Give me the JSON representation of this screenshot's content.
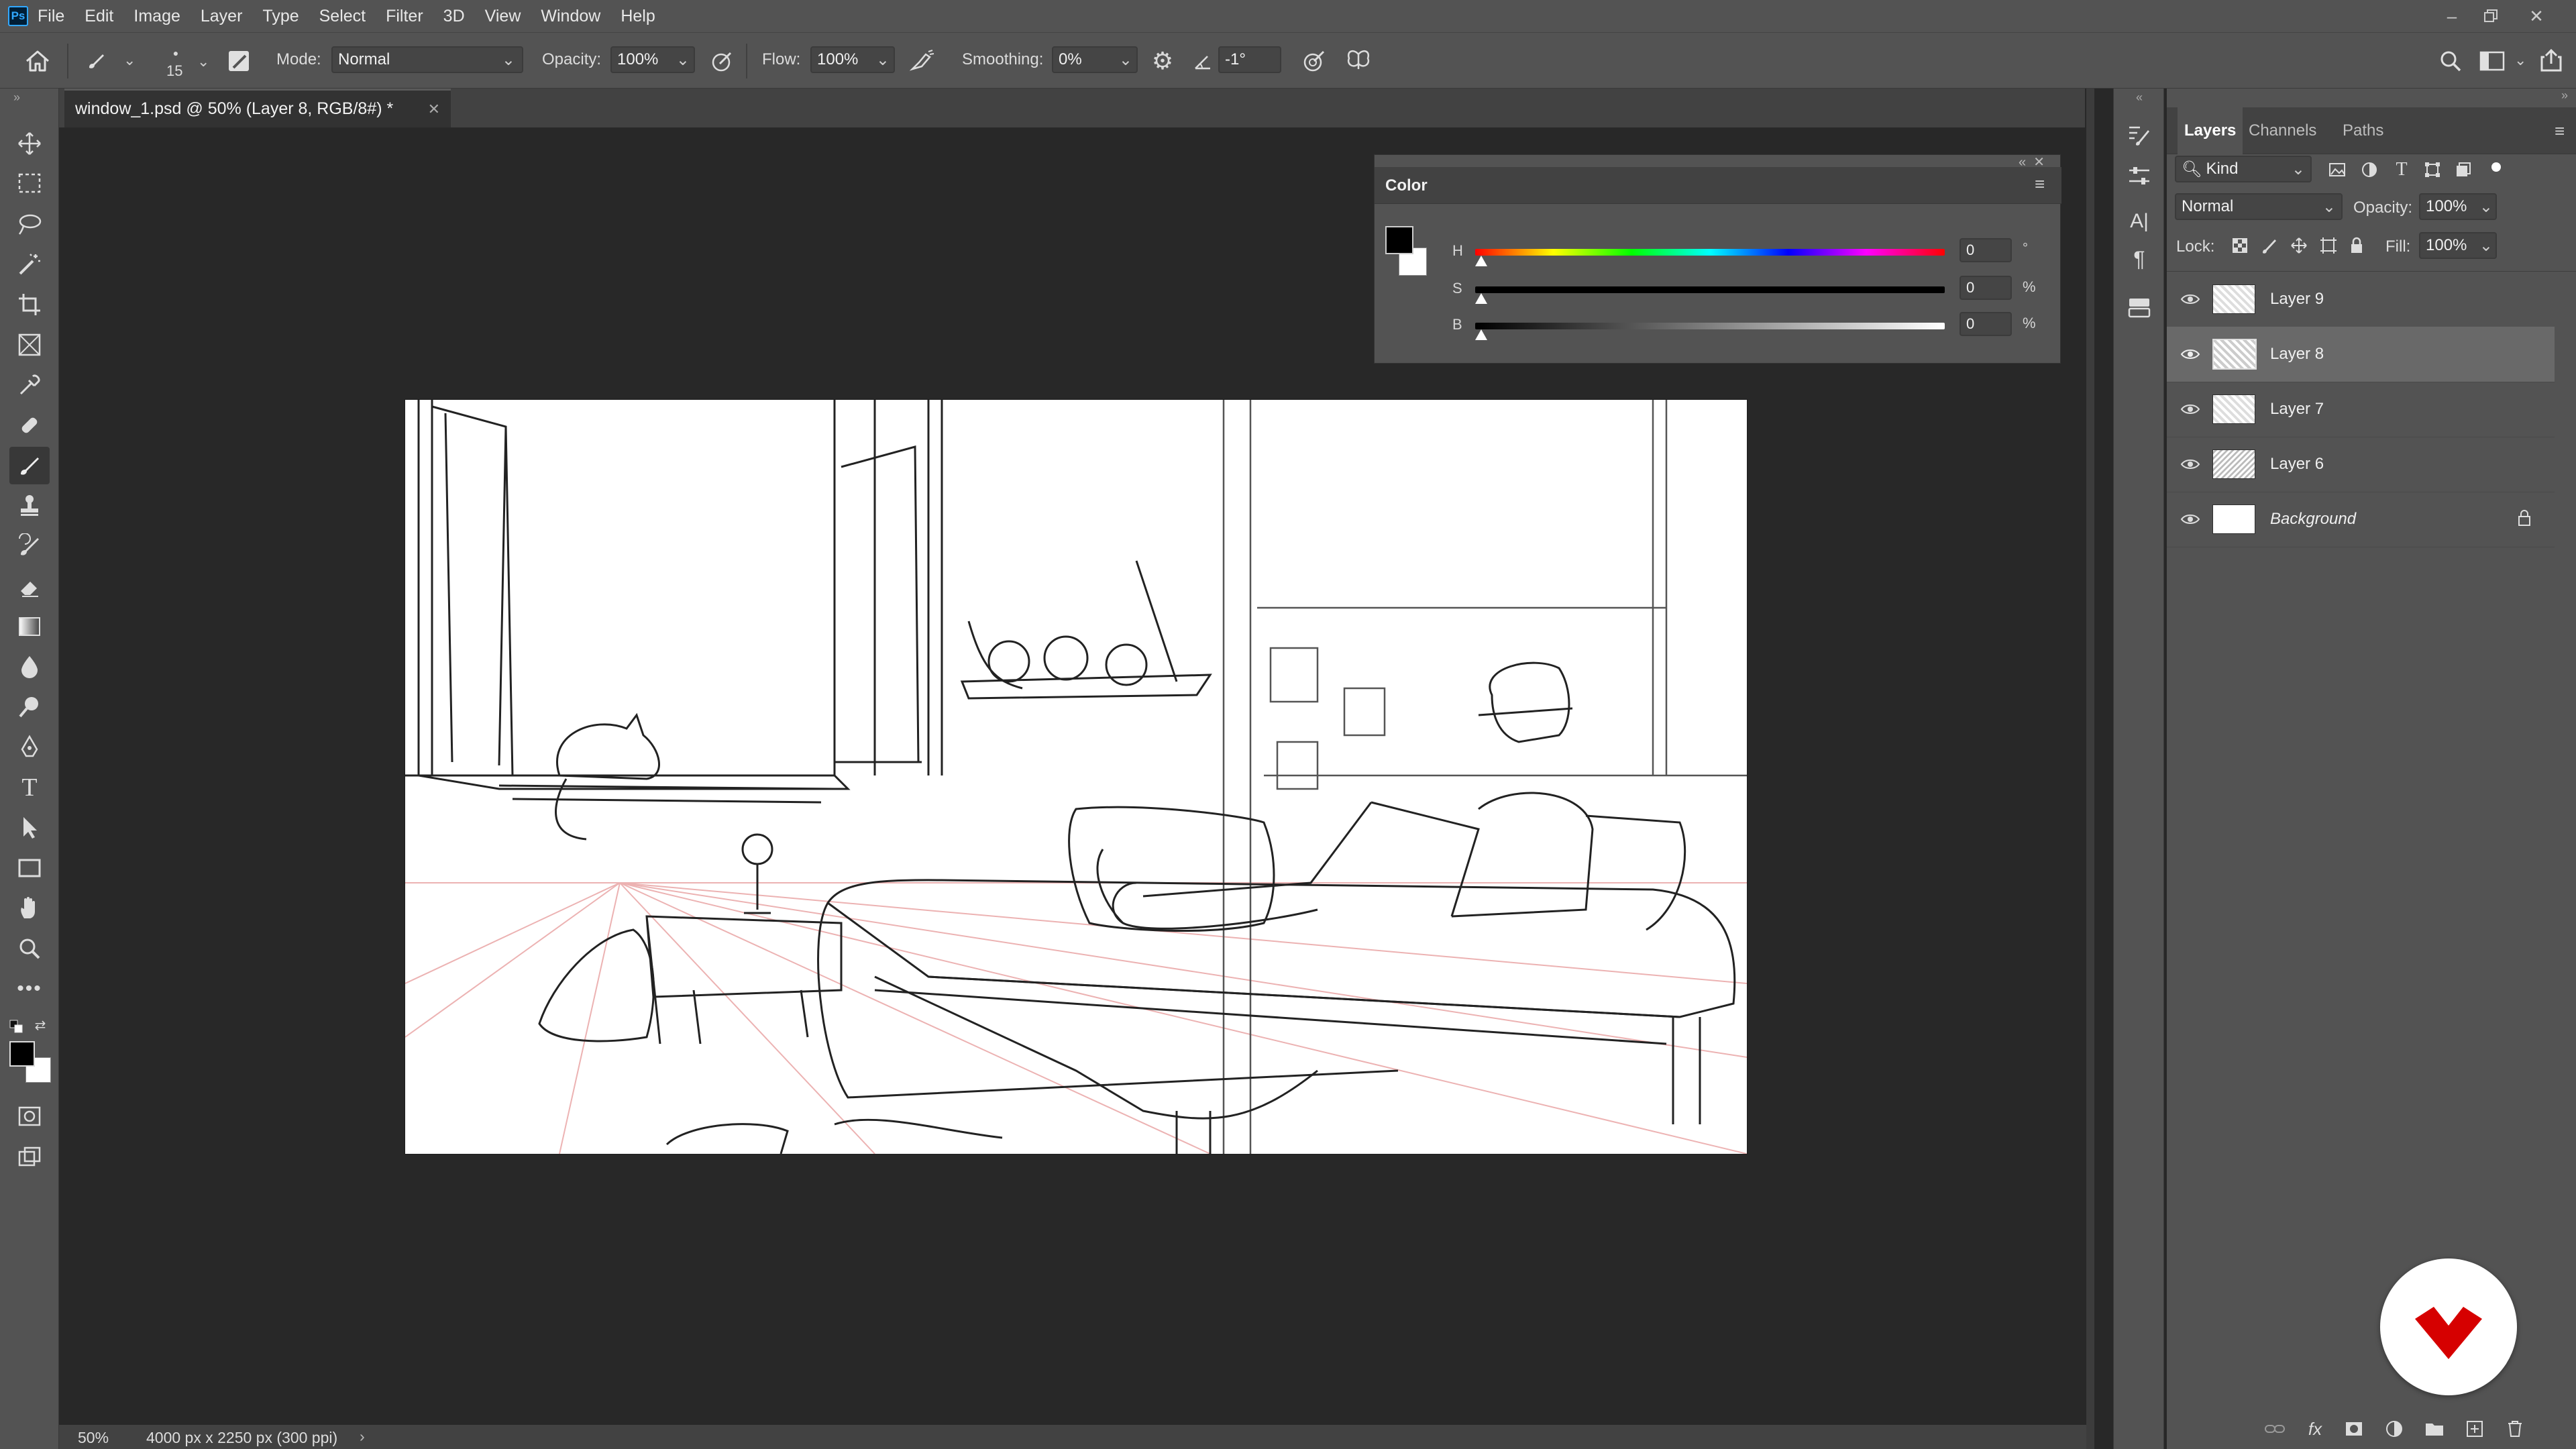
{
  "app": {
    "logo_text": "Ps"
  },
  "menu": [
    "File",
    "Edit",
    "Image",
    "Layer",
    "Type",
    "Select",
    "Filter",
    "3D",
    "View",
    "Window",
    "Help"
  ],
  "options": {
    "brush_size": "15",
    "mode_label": "Mode:",
    "mode_value": "Normal",
    "opacity_label": "Opacity:",
    "opacity_value": "100%",
    "flow_label": "Flow:",
    "flow_value": "100%",
    "smoothing_label": "Smoothing:",
    "smoothing_value": "0%",
    "angle_value": "-1°"
  },
  "document": {
    "tab_title": "window_1.psd @ 50% (Layer 8, RGB/8#) *",
    "zoom": "50%",
    "doc_info": "4000 px x 2250 px (300 ppi)"
  },
  "color_panel": {
    "title": "Color",
    "h_label": "H",
    "h_value": "0",
    "h_unit": "°",
    "s_label": "S",
    "s_value": "0",
    "s_unit": "%",
    "b_label": "B",
    "b_value": "0",
    "b_unit": "%"
  },
  "layers_panel": {
    "tabs": [
      "Layers",
      "Channels",
      "Paths"
    ],
    "filter_kind": "Kind",
    "blend_mode": "Normal",
    "opacity_label": "Opacity:",
    "opacity_value": "100%",
    "lock_label": "Lock:",
    "fill_label": "Fill:",
    "fill_value": "100%",
    "layers": [
      {
        "name": "Layer 9"
      },
      {
        "name": "Layer 8"
      },
      {
        "name": "Layer 7"
      },
      {
        "name": "Layer 6"
      },
      {
        "name": "Background"
      }
    ]
  },
  "colors": {
    "ui_bg": "#535353",
    "canvas_bg": "#282828",
    "accent_red": "#d60000"
  }
}
